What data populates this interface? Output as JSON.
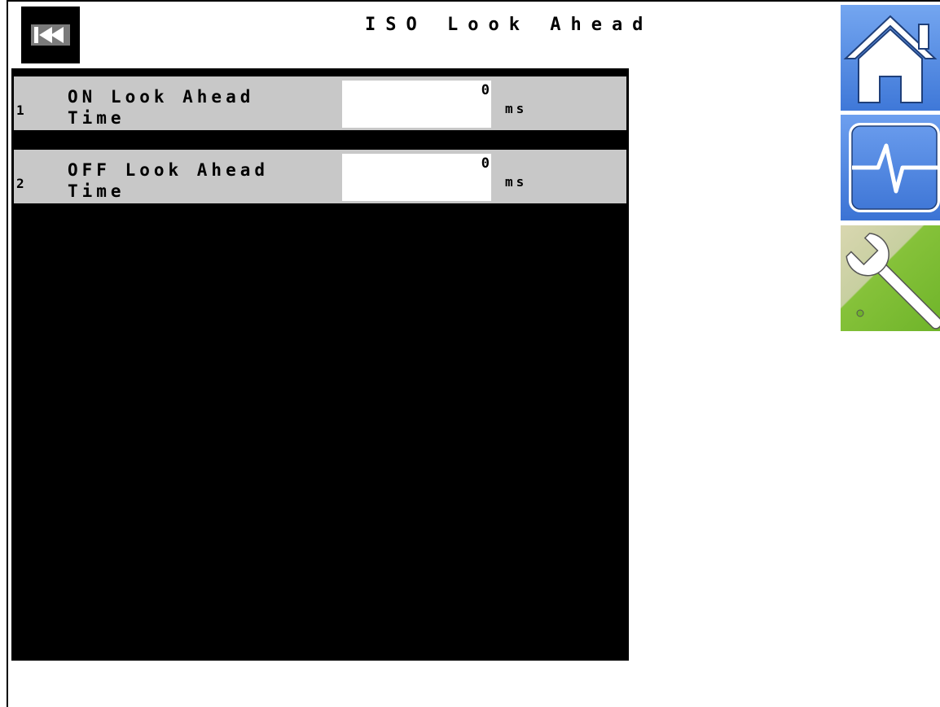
{
  "screen": {
    "title": "ISO Look Ahead"
  },
  "rows": [
    {
      "index": "1",
      "label_line1": "ON Look Ahead",
      "label_line2": "Time",
      "value": "0",
      "unit": "ms"
    },
    {
      "index": "2",
      "label_line1": "OFF Look Ahead",
      "label_line2": "Time",
      "value": "0",
      "unit": "ms"
    }
  ],
  "softkeys": {
    "back": "skip-back-icon",
    "home": "home-icon",
    "diagnostics": "pulse-icon",
    "tools": "wrench-icon"
  },
  "colors": {
    "row_background": "#c8c8c8",
    "panel_background": "#000000",
    "softkey_blue": "#4a82dc",
    "softkey_green": "#7ebc34"
  }
}
